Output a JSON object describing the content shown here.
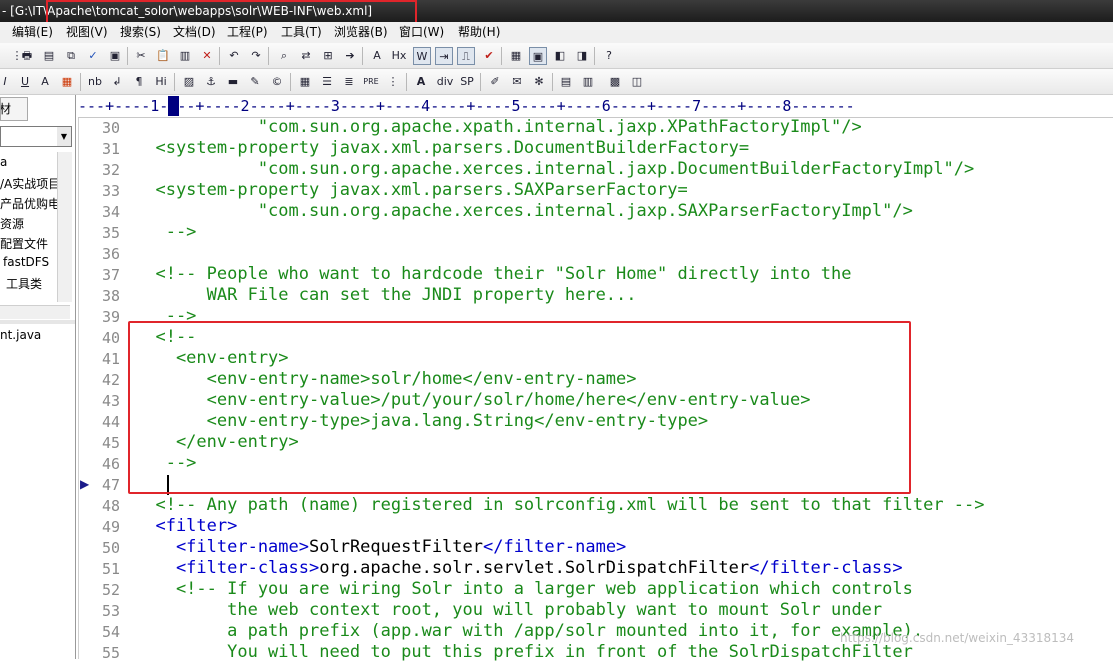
{
  "window": {
    "title": "- [G:\\IT\\Apache\\tomcat_solor\\webapps\\solr\\WEB-INF\\web.xml]"
  },
  "menubar": {
    "items": [
      "编辑(E)",
      "视图(V)",
      "搜索(S)",
      "文档(D)",
      "工程(P)",
      "工具(T)",
      "浏览器(B)",
      "窗口(W)",
      "帮助(H)"
    ]
  },
  "toolbar2": {
    "text_buttons": [
      "I",
      "U",
      "A",
      "nb",
      "¶",
      "Hi",
      "PRE",
      "A",
      "div",
      "SP"
    ]
  },
  "left_panel": {
    "tab_label": "材",
    "tree_items": [
      "a",
      "/A实战项目",
      "产品优购电商",
      "资源",
      "配置文件",
      "fastDFS",
      "工具类"
    ],
    "file_item": "nt.java"
  },
  "ruler": {
    "text": "---+----1----+----2----+----3----+----4----+----5----+----6----+----7----+----8-------"
  },
  "editor": {
    "lines": [
      {
        "n": "30",
        "segs": [
          {
            "t": "            \"com.sun.org.apache.xpath.internal.jaxp.XPathFactoryImpl\"/>",
            "c": "comment"
          }
        ]
      },
      {
        "n": "31",
        "segs": [
          {
            "t": "  <system-property javax.xml.parsers.DocumentBuilderFactory=",
            "c": "comment"
          }
        ]
      },
      {
        "n": "32",
        "segs": [
          {
            "t": "            \"com.sun.org.apache.xerces.internal.jaxp.DocumentBuilderFactoryImpl\"/>",
            "c": "comment"
          }
        ]
      },
      {
        "n": "33",
        "segs": [
          {
            "t": "  <system-property javax.xml.parsers.SAXParserFactory=",
            "c": "comment"
          }
        ]
      },
      {
        "n": "34",
        "segs": [
          {
            "t": "            \"com.sun.org.apache.xerces.internal.jaxp.SAXParserFactoryImpl\"/>",
            "c": "comment"
          }
        ]
      },
      {
        "n": "35",
        "segs": [
          {
            "t": "   -->",
            "c": "comment"
          }
        ]
      },
      {
        "n": "36",
        "segs": []
      },
      {
        "n": "37",
        "segs": [
          {
            "t": "  <!-- People who want to hardcode their \"Solr Home\" directly into the",
            "c": "comment"
          }
        ]
      },
      {
        "n": "38",
        "segs": [
          {
            "t": "       WAR File can set the JNDI property here...",
            "c": "comment"
          }
        ]
      },
      {
        "n": "39",
        "segs": [
          {
            "t": "   -->",
            "c": "comment"
          }
        ]
      },
      {
        "n": "40",
        "segs": [
          {
            "t": "  <!--",
            "c": "comment"
          }
        ]
      },
      {
        "n": "41",
        "segs": [
          {
            "t": "    <env-entry>",
            "c": "comment"
          }
        ]
      },
      {
        "n": "42",
        "segs": [
          {
            "t": "       <env-entry-name>solr/home</env-entry-name>",
            "c": "comment"
          }
        ]
      },
      {
        "n": "43",
        "segs": [
          {
            "t": "       <env-entry-value>/put/your/solr/home/here</env-entry-value>",
            "c": "comment"
          }
        ]
      },
      {
        "n": "44",
        "segs": [
          {
            "t": "       <env-entry-type>java.lang.String</env-entry-type>",
            "c": "comment"
          }
        ]
      },
      {
        "n": "45",
        "segs": [
          {
            "t": "    </env-entry>",
            "c": "comment"
          }
        ]
      },
      {
        "n": "46",
        "segs": [
          {
            "t": "   -->",
            "c": "comment"
          }
        ]
      },
      {
        "n": "47",
        "segs": []
      },
      {
        "n": "48",
        "segs": [
          {
            "t": "  <!-- Any path (name) registered in solrconfig.xml will be sent to that filter -->",
            "c": "comment"
          }
        ]
      },
      {
        "n": "49",
        "segs": [
          {
            "t": "  <filter>",
            "c": "tag"
          }
        ]
      },
      {
        "n": "50",
        "segs": [
          {
            "t": "    <filter-name>",
            "c": "tag"
          },
          {
            "t": "SolrRequestFilter",
            "c": "txt"
          },
          {
            "t": "</filter-name>",
            "c": "tag"
          }
        ]
      },
      {
        "n": "51",
        "segs": [
          {
            "t": "    <filter-class>",
            "c": "tag"
          },
          {
            "t": "org.apache.solr.servlet.SolrDispatchFilter",
            "c": "txt"
          },
          {
            "t": "</filter-class>",
            "c": "tag"
          }
        ]
      },
      {
        "n": "52",
        "segs": [
          {
            "t": "    <!-- If you are wiring Solr into a larger web application which controls",
            "c": "comment"
          }
        ]
      },
      {
        "n": "53",
        "segs": [
          {
            "t": "         the web context root, you will probably want to mount Solr under",
            "c": "comment"
          }
        ]
      },
      {
        "n": "54",
        "segs": [
          {
            "t": "         a path prefix (app.war with /app/solr mounted into it, for example).",
            "c": "comment"
          }
        ]
      },
      {
        "n": "55",
        "segs": [
          {
            "t": "         You will need to put this prefix in front of the SolrDispatchFilter",
            "c": "comment"
          }
        ]
      }
    ]
  },
  "watermark": "https://blog.csdn.net/weixin_43318134",
  "colors": {
    "comment": "#1a8a1a",
    "tag": "#0000cc",
    "text": "#000000",
    "highlight_box": "#e0252b"
  }
}
